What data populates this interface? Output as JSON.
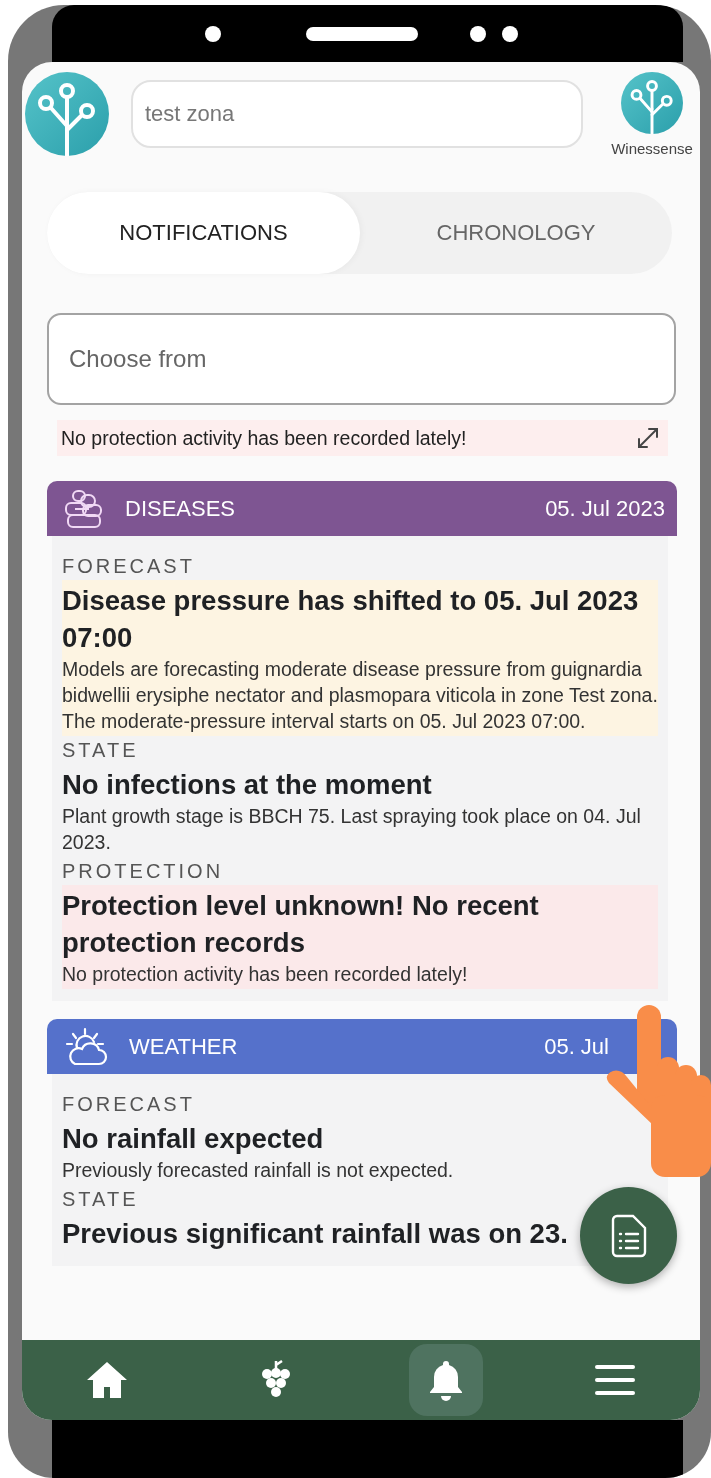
{
  "header": {
    "zone_field": {
      "value": "test zona"
    },
    "brand_label": "Winessense"
  },
  "tabs": [
    {
      "label": "NOTIFICATIONS",
      "selected": true
    },
    {
      "label": "CHRONOLOGY",
      "selected": false
    }
  ],
  "choose_field": {
    "placeholder": "Choose from"
  },
  "alert": {
    "text": "No protection activity has been recorded lately!"
  },
  "cards": [
    {
      "kind": "diseases",
      "title": "DISEASES",
      "date": "05. Jul 2023",
      "color": "#7e5592",
      "sections": [
        {
          "label": "FORECAST",
          "title": "Disease pressure has shifted to 05. Jul 2023 07:00",
          "text": "Models are forecasting moderate disease pressure from guignardia bidwellii erysiphe nectator and plasmopara viticola in zone Test zona. The moderate-pressure interval starts on 05. Jul 2023 07:00.",
          "color": "#fdf4e2"
        },
        {
          "label": "STATE",
          "title": "No infections at the moment",
          "text": "Plant growth stage is BBCH 75. Last spraying took place on 04. Jul 2023."
        },
        {
          "label": "PROTECTION",
          "title": "Protection level unknown! No recent protection records",
          "text": "No protection activity has been recorded lately!",
          "color": "#fbe9ea"
        }
      ]
    },
    {
      "kind": "weather",
      "title": "WEATHER",
      "date": "05. Jul",
      "color": "#5571cb",
      "sections": [
        {
          "label": "FORECAST",
          "title": "No rainfall expected",
          "text": "Previously forecasted rainfall is not expected."
        },
        {
          "label": "STATE",
          "title": "Previous significant rainfall was on 23."
        }
      ]
    }
  ],
  "nav": [
    {
      "selected": false
    },
    {
      "selected": false
    },
    {
      "selected": true
    },
    {
      "selected": false
    }
  ]
}
